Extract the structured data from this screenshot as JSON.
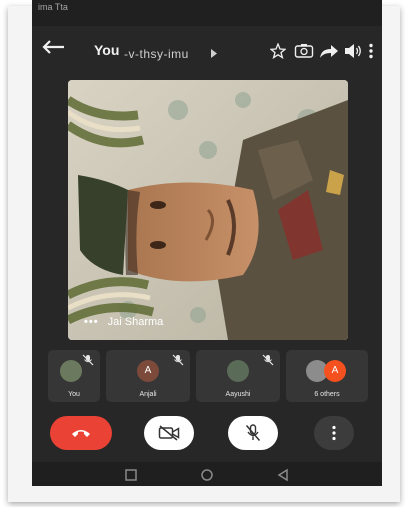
{
  "statusbar": {
    "time": "ima Tta"
  },
  "header": {
    "you_label": "You",
    "meeting_code": "-v-thsy-imu",
    "icons": [
      "back-arrow-icon",
      "star-icon",
      "switch-camera-icon",
      "share-icon",
      "speaker-icon",
      "more-vert-icon"
    ]
  },
  "main_video": {
    "participant_name": "Jai Sharma",
    "dots": "•••"
  },
  "participants": [
    {
      "name": "You",
      "initial": "",
      "avatar_color": "#6b7a5e",
      "muted": true
    },
    {
      "name": "Anjali",
      "initial": "A",
      "avatar_color": "#7b4a3a",
      "muted": true
    },
    {
      "name": "Aayushi",
      "initial": "",
      "avatar_color": "#5a6b58",
      "muted": true
    },
    {
      "name": "6 others",
      "initial": "A",
      "avatar_color": "#f4511e",
      "muted": false
    }
  ],
  "colors": {
    "background": "#272727",
    "tile": "#363636",
    "end_call": "#ea4335",
    "control_light": "#ffffff",
    "control_dark": "#3c3c3c"
  }
}
